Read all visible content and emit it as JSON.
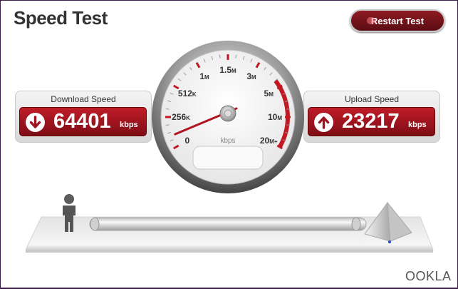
{
  "app": {
    "title": "Speed Test",
    "brand": "OOKLA"
  },
  "toolbar": {
    "restart_label": "Restart Test"
  },
  "download": {
    "label": "Download Speed",
    "value": "64401",
    "unit": "kbps"
  },
  "upload": {
    "label": "Upload Speed",
    "value": "23217",
    "unit": "kbps"
  },
  "gauge": {
    "ticks": [
      {
        "text": "0",
        "small": ""
      },
      {
        "text": "256",
        "small": "K"
      },
      {
        "text": "512",
        "small": "K"
      },
      {
        "text": "1",
        "small": "M"
      },
      {
        "text": "1.5",
        "small": "M"
      },
      {
        "text": "3",
        "small": "M"
      },
      {
        "text": "5",
        "small": "M"
      },
      {
        "text": "10",
        "small": "M"
      },
      {
        "text": "20",
        "small": "M+"
      }
    ],
    "unit_label": "kbps",
    "needle_position": 0.05
  },
  "colors": {
    "accent": "#a8131e",
    "brand_orange": "#e05a1a"
  }
}
